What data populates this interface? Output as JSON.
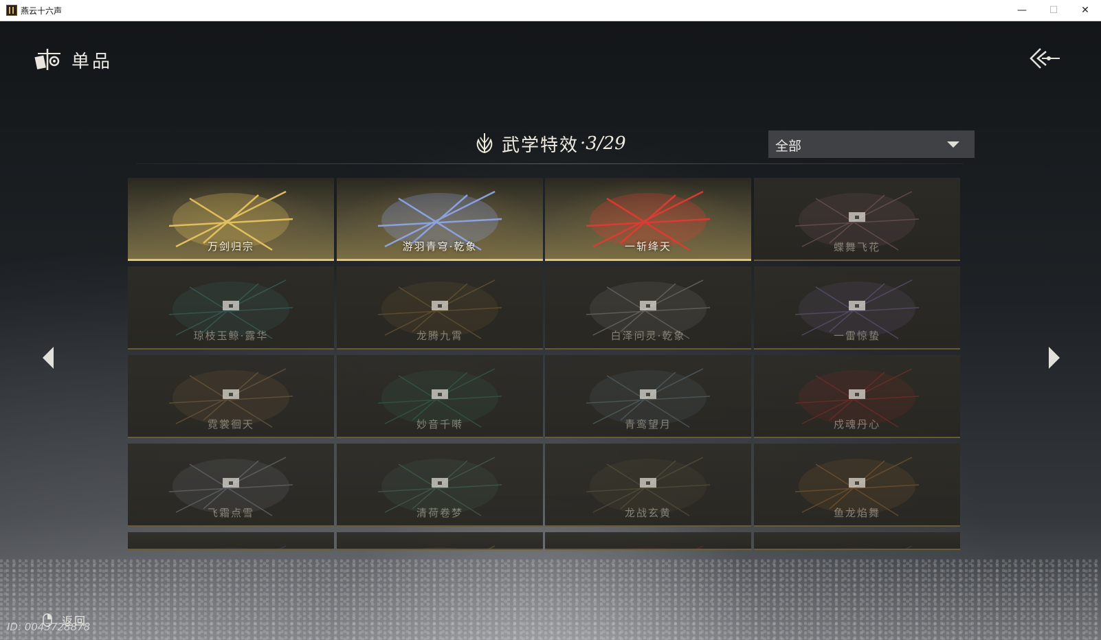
{
  "window": {
    "title": "燕云十六声",
    "minimize": "—",
    "maximize": "☐",
    "close": "✕"
  },
  "header": {
    "title": "单品",
    "icon": "collection-icon",
    "back_icon": "triple-chevron-back-icon"
  },
  "section": {
    "label": "武学特效",
    "count": "·3/29",
    "icon": "lotus-emblem-icon"
  },
  "filter": {
    "value": "全部"
  },
  "effects": [
    {
      "name": "万剑归宗",
      "unlocked": true,
      "art": "golden-swords",
      "color": "#e8c460"
    },
    {
      "name": "游羽青穹·乾象",
      "unlocked": true,
      "art": "blue-phoenix",
      "color": "#8fa6e8"
    },
    {
      "name": "一斩绛天",
      "unlocked": true,
      "art": "red-slashes",
      "color": "#e23a32"
    },
    {
      "name": "蝶舞飞花",
      "unlocked": false,
      "art": "pink-butterfly",
      "color": "#c88a98"
    },
    {
      "name": "琼枝玉鲸·露华",
      "unlocked": false,
      "art": "teal-whale",
      "color": "#4aa6a0"
    },
    {
      "name": "龙腾九霄",
      "unlocked": false,
      "art": "gold-dragon",
      "color": "#b08c40"
    },
    {
      "name": "白泽问灵·乾象",
      "unlocked": false,
      "art": "white-beast",
      "color": "#bcbcbc"
    },
    {
      "name": "一雷惊蛰",
      "unlocked": false,
      "art": "purple-lightning",
      "color": "#9a86d0"
    },
    {
      "name": "霓裳徊天",
      "unlocked": false,
      "art": "celestial-dancer",
      "color": "#c09058"
    },
    {
      "name": "妙音千啭",
      "unlocked": false,
      "art": "green-birds",
      "color": "#3a9a78"
    },
    {
      "name": "青鸾望月",
      "unlocked": false,
      "art": "moon-crane",
      "color": "#7ea2b0"
    },
    {
      "name": "戍魂丹心",
      "unlocked": false,
      "art": "red-lightning",
      "color": "#d0302c"
    },
    {
      "name": "飞霜点雪",
      "unlocked": false,
      "art": "snow-pavilion",
      "color": "#aab4c4"
    },
    {
      "name": "清荷卷梦",
      "unlocked": false,
      "art": "lotus-pond",
      "color": "#5e9a80"
    },
    {
      "name": "龙战玄黄",
      "unlocked": false,
      "art": "dark-rings",
      "color": "#8a7a50"
    },
    {
      "name": "鱼龙焰舞",
      "unlocked": false,
      "art": "golden-koi",
      "color": "#d08a3a"
    },
    {
      "name": "",
      "unlocked": false,
      "art": "partial-blue",
      "color": "#4a5a8a"
    },
    {
      "name": "",
      "unlocked": false,
      "art": "partial-gold",
      "color": "#9a8a4a"
    },
    {
      "name": "",
      "unlocked": false,
      "art": "partial-red",
      "color": "#9a2a28"
    },
    {
      "name": "",
      "unlocked": false,
      "art": "partial-dark",
      "color": "#5a5048"
    }
  ],
  "nav": {
    "prev_icon": "chevron-left-icon",
    "next_icon": "chevron-right-icon"
  },
  "footer": {
    "back_label": "返回",
    "mouse_icon": "mouse-right-click-icon",
    "player_id": "ID: 0043728878"
  }
}
